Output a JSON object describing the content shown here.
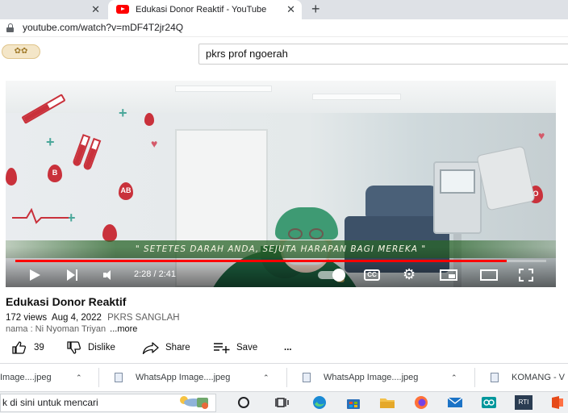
{
  "browser": {
    "prev_tab_close": "✕",
    "active_tab_title": "Edukasi Donor Reaktif - YouTube",
    "active_tab_close": "✕",
    "new_tab": "+",
    "url": "youtube.com/watch?v=mDF4T2jr24Q"
  },
  "youtube": {
    "search_value": "pkrs prof ngoerah"
  },
  "video": {
    "caption": "\" SETETES DARAH ANDA, SEJUTA HARAPAN BAGI MEREKA \"",
    "time": "2:28 / 2:41",
    "progress": 0.925,
    "cc_label": "CC"
  },
  "info": {
    "title": "Edukasi Donor Reaktif",
    "views": "172 views",
    "date": "Aug 4, 2022",
    "channel": "PKRS SANGLAH",
    "description": "nama :  Ni Nyoman Triyan",
    "more": "...more"
  },
  "actions": {
    "likes": "39",
    "dislike": "Dislike",
    "share": "Share",
    "save": "Save",
    "more": "..."
  },
  "downloads": [
    {
      "name": "Image....jpeg"
    },
    {
      "name": "WhatsApp Image....jpeg"
    },
    {
      "name": "WhatsApp Image....jpeg"
    },
    {
      "name": "KOMANG - V"
    }
  ],
  "taskbar": {
    "search_text": "k di sini untuk mencari",
    "app_label": "RTI"
  },
  "colors": {
    "accent": "#ff0000",
    "tab_strip": "#dee1e6",
    "scrubs": "#1f6b46"
  }
}
